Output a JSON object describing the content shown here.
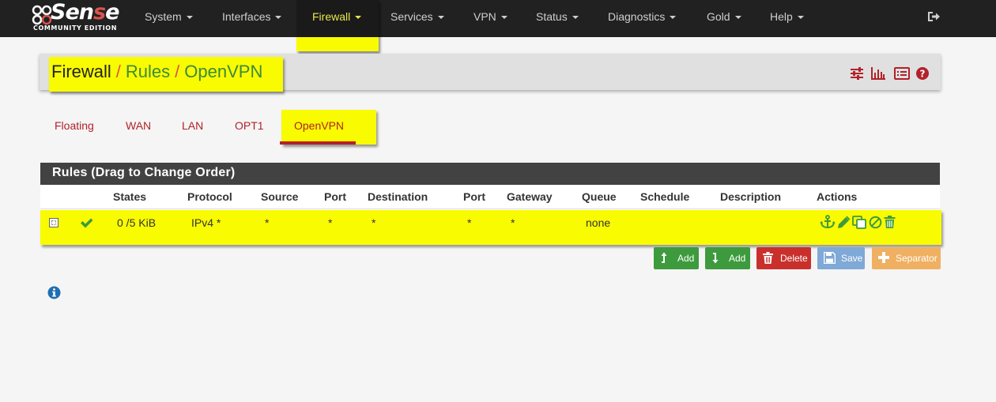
{
  "brand": {
    "logo_word_a": "Sen",
    "logo_word_b": "s",
    "logo_word_c": "e",
    "edition": "COMMUNITY EDITION"
  },
  "nav": {
    "items": [
      {
        "label": "System"
      },
      {
        "label": "Interfaces"
      },
      {
        "label": "Firewall"
      },
      {
        "label": "Services"
      },
      {
        "label": "VPN"
      },
      {
        "label": "Status"
      },
      {
        "label": "Diagnostics"
      },
      {
        "label": "Gold"
      },
      {
        "label": "Help"
      }
    ],
    "active": "Firewall",
    "logout_icon": "sign-out-icon"
  },
  "breadcrumb": {
    "items": [
      "Firewall",
      "Rules",
      "OpenVPN"
    ],
    "separator": "/"
  },
  "panel_icons": [
    "sliders-icon",
    "bar-chart-icon",
    "list-alt-icon",
    "question-circle-icon"
  ],
  "tabs": {
    "items": [
      "Floating",
      "WAN",
      "LAN",
      "OPT1",
      "OpenVPN"
    ],
    "active": "OpenVPN"
  },
  "rules": {
    "title": "Rules (Drag to Change Order)",
    "columns": [
      "States",
      "Protocol",
      "Source",
      "Port",
      "Destination",
      "Port",
      "Gateway",
      "Queue",
      "Schedule",
      "Description",
      "Actions"
    ],
    "rows": [
      {
        "enabled_icon": "check-icon",
        "states": "0 /5 KiB",
        "protocol": "IPv4 *",
        "source": "*",
        "source_port": "*",
        "destination": "*",
        "destination_port": "*",
        "gateway": "*",
        "queue": "none",
        "schedule": "",
        "description": "",
        "actions": [
          "anchor-icon",
          "pencil-icon",
          "copy-icon",
          "ban-icon",
          "trash-icon"
        ]
      }
    ]
  },
  "buttons": {
    "add_top": "Add",
    "add_bottom": "Add",
    "delete": "Delete",
    "save": "Save",
    "separator": "Separator"
  },
  "colors": {
    "navbar": "#212121",
    "highlight": "#f9fb00",
    "brand_red": "#b2212a",
    "success": "#3d9b3d",
    "danger": "#c9302c",
    "primary_disabled": "#7fa9d6",
    "warning_disabled": "#f0b061"
  },
  "info_icon": "info-circle-icon"
}
